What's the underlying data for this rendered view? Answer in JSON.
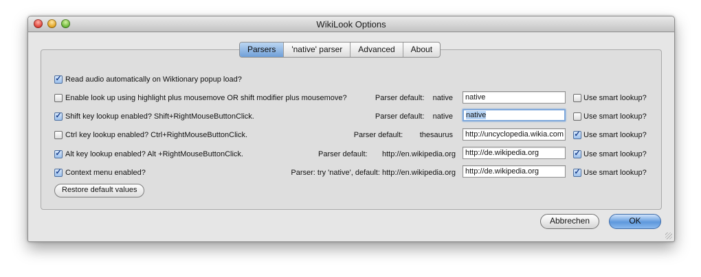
{
  "window": {
    "title": "WikiLook Options"
  },
  "tabs": [
    {
      "label": "Parsers",
      "active": true
    },
    {
      "label": "'native' parser",
      "active": false
    },
    {
      "label": "Advanced",
      "active": false
    },
    {
      "label": "About",
      "active": false
    }
  ],
  "rows": [
    {
      "label": "Read audio automatically on Wiktionary popup load?",
      "checked": true
    },
    {
      "label": "Enable look up using highlight plus mousemove OR shift modifier plus mousemove?",
      "checked": false,
      "parser_prefix": "Parser default:",
      "parser_default": "native",
      "field_value": "native",
      "smart_label": "Use smart lookup?",
      "smart_checked": false
    },
    {
      "label": "Shift key lookup enabled? Shift+RightMouseButtonClick.",
      "checked": true,
      "parser_prefix": "Parser default:",
      "parser_default": "native",
      "field_value": "native",
      "smart_label": "Use smart lookup?",
      "smart_checked": false
    },
    {
      "label": "Ctrl key lookup enabled? Ctrl+RightMouseButtonClick.",
      "checked": false,
      "parser_prefix": "Parser default:",
      "parser_default": "thesaurus",
      "field_value": "http://uncyclopedia.wikia.com",
      "smart_label": "Use smart lookup?",
      "smart_checked": true
    },
    {
      "label": "Alt key lookup enabled? Alt +RightMouseButtonClick.",
      "checked": true,
      "parser_prefix": "Parser default:",
      "parser_default": "http://en.wikipedia.org",
      "field_value": "http://de.wikipedia.org",
      "smart_label": "Use smart lookup?",
      "smart_checked": true
    },
    {
      "label": "Context menu enabled?",
      "checked": true,
      "parser_prefix": "Parser: try 'native', default:",
      "parser_default": "http://en.wikipedia.org",
      "field_value": "http://de.wikipedia.org",
      "smart_label": "Use smart lookup?",
      "smart_checked": true
    }
  ],
  "buttons": {
    "restore": "Restore default values",
    "cancel": "Abbrechen",
    "ok": "OK"
  },
  "colors": {
    "accent": "#6f9fd8",
    "window_bg": "#e6e6e6"
  }
}
